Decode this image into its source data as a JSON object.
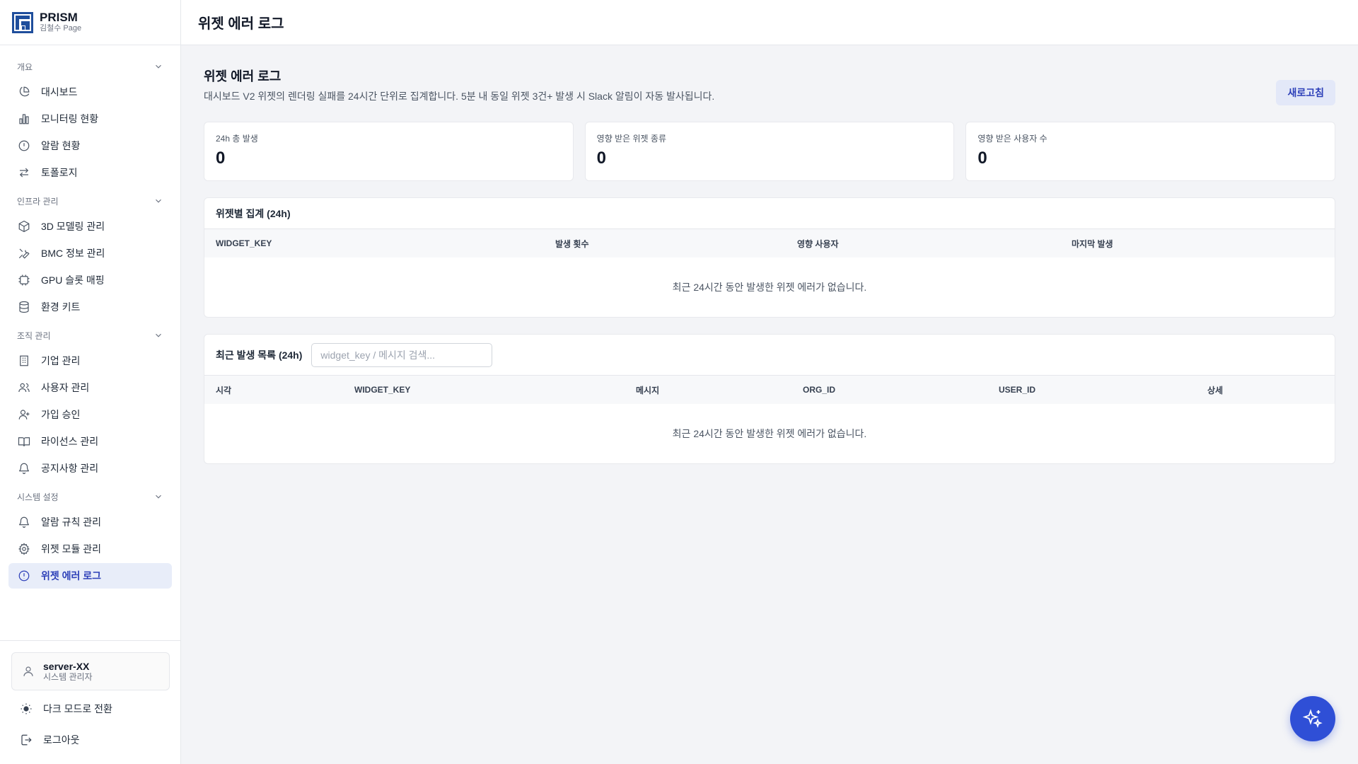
{
  "brand": {
    "name": "PRISM",
    "subtitle": "김철수 Page"
  },
  "sidebar": {
    "groups": [
      {
        "label": "개요",
        "items": [
          {
            "label": "대시보드",
            "icon": "pie-chart-icon"
          },
          {
            "label": "모니터링 현황",
            "icon": "bar-chart-icon"
          },
          {
            "label": "알람 현황",
            "icon": "alert-circle-icon"
          },
          {
            "label": "토폴로지",
            "icon": "arrows-swap-icon"
          }
        ]
      },
      {
        "label": "인프라 관리",
        "items": [
          {
            "label": "3D 모델링 관리",
            "icon": "cube-icon"
          },
          {
            "label": "BMC 정보 관리",
            "icon": "wrench-icon"
          },
          {
            "label": "GPU 슬롯 매핑",
            "icon": "chip-icon"
          },
          {
            "label": "환경 키트",
            "icon": "database-icon"
          }
        ]
      },
      {
        "label": "조직 관리",
        "items": [
          {
            "label": "기업 관리",
            "icon": "building-icon"
          },
          {
            "label": "사용자 관리",
            "icon": "users-icon"
          },
          {
            "label": "가입 승인",
            "icon": "user-plus-icon"
          },
          {
            "label": "라이선스 관리",
            "icon": "book-icon"
          },
          {
            "label": "공지사항 관리",
            "icon": "bell-icon"
          }
        ]
      },
      {
        "label": "시스템 설정",
        "items": [
          {
            "label": "알람 규칙 관리",
            "icon": "bell-icon"
          },
          {
            "label": "위젯 모듈 관리",
            "icon": "gear-icon"
          },
          {
            "label": "위젯 에러 로그",
            "icon": "alert-circle-icon",
            "active": true
          }
        ]
      }
    ],
    "user": {
      "name": "server-XX",
      "role": "시스템 관리자"
    },
    "dark_mode_label": "다크 모드로 전환",
    "logout_label": "로그아웃"
  },
  "topbar": {
    "title": "위젯 에러 로그"
  },
  "main": {
    "title": "위젯 에러 로그",
    "description": "대시보드 V2 위젯의 렌더링 실패를 24시간 단위로 집계합니다. 5분 내 동일 위젯 3건+ 발생 시 Slack 알림이 자동 발사됩니다.",
    "refresh_label": "새로고침",
    "stats": [
      {
        "label": "24h 총 발생",
        "value": "0"
      },
      {
        "label": "영향 받은 위젯 종류",
        "value": "0"
      },
      {
        "label": "영향 받은 사용자 수",
        "value": "0"
      }
    ],
    "summary": {
      "title": "위젯별 집계 (24h)",
      "columns": [
        "WIDGET_KEY",
        "발생 횟수",
        "영향 사용자",
        "마지막 발생"
      ],
      "empty": "최근 24시간 동안 발생한 위젯 에러가 없습니다."
    },
    "recent": {
      "title": "최근 발생 목록 (24h)",
      "search_placeholder": "widget_key / 메시지 검색...",
      "columns": [
        "시각",
        "WIDGET_KEY",
        "메시지",
        "ORG_ID",
        "USER_ID",
        "상세"
      ],
      "empty": "최근 24시간 동안 발생한 위젯 에러가 없습니다."
    }
  },
  "colors": {
    "accent": "#2c3fb8",
    "fab": "#2f4fd6",
    "active_bg": "#e8edf9"
  }
}
